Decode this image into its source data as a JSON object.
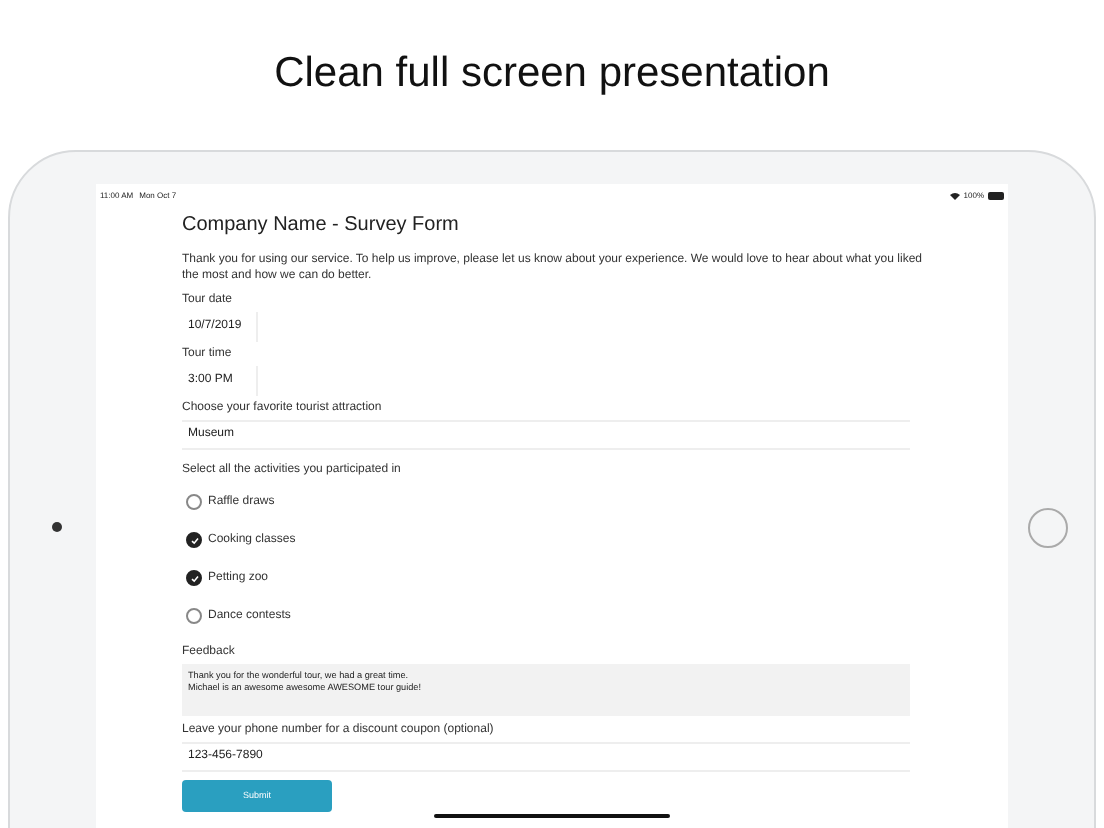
{
  "headline": "Clean full screen presentation",
  "status_bar": {
    "time": "11:00 AM",
    "date": "Mon Oct 7",
    "battery": "100%"
  },
  "form": {
    "title": "Company Name - Survey Form",
    "intro": "Thank you for using our service.  To help us improve, please let us know about your experience.  We would love to hear about what you liked the most and how we can do better.",
    "fields": [
      {
        "kind": "short",
        "label": "Tour date",
        "value": "10/7/2019"
      },
      {
        "kind": "short",
        "label": "Tour time",
        "value": "3:00 PM"
      },
      {
        "kind": "wide",
        "label": "Choose your favorite tourist attraction",
        "value": "Museum"
      },
      {
        "kind": "checklist",
        "label": "Select all the activities you participated in",
        "options": [
          {
            "label": "Raffle draws",
            "checked": false
          },
          {
            "label": "Cooking classes",
            "checked": true
          },
          {
            "label": "Petting zoo",
            "checked": true
          },
          {
            "label": "Dance contests",
            "checked": false
          }
        ]
      },
      {
        "kind": "textarea",
        "label": "Feedback",
        "lines": [
          "Thank you for the wonderful tour, we had a great time.",
          "Michael is an awesome awesome AWESOME tour guide!"
        ]
      },
      {
        "kind": "wide",
        "label": "Leave your phone number for a discount coupon (optional)",
        "value": "123-456-7890"
      }
    ],
    "submit": "Submit"
  }
}
